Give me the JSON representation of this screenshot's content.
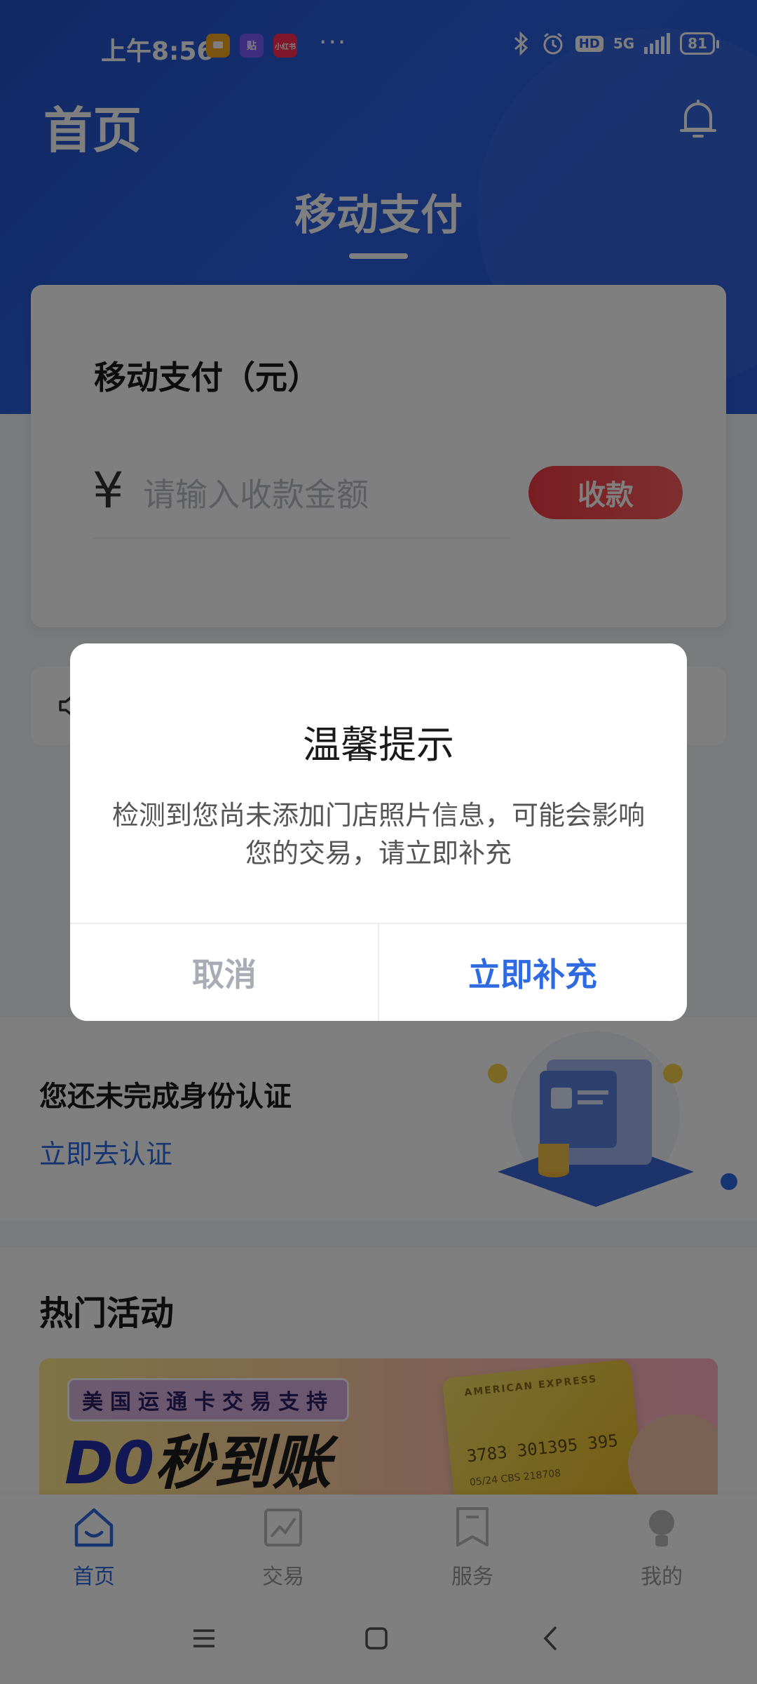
{
  "status_bar": {
    "time": "上午8:56",
    "notif_icons": [
      "chat-icon",
      "tieba-icon",
      "xiaohongshu-icon"
    ],
    "notif_labels": [
      "",
      "贴",
      "小红书"
    ],
    "more": "···",
    "network": "5G",
    "hd": "HD",
    "battery": "81"
  },
  "header": {
    "title": "首页"
  },
  "hero_tab": "移动支付",
  "pay_card": {
    "title": "移动支付（元）",
    "currency_symbol": "¥",
    "amount_placeholder": "请输入收款金额",
    "collect_button": "收款"
  },
  "verify": {
    "title": "您还未完成身份认证",
    "link": "立即去认证"
  },
  "activity": {
    "title": "热门活动",
    "banner_tag": "美国运通卡交易支持",
    "banner_do": "D0",
    "banner_headline": "秒到账",
    "card_brand": "AMERICAN EXPRESS",
    "card_number": "3783 301395 395",
    "card_sub": "05/24   CBS 218708"
  },
  "tabbar": [
    {
      "label": "首页",
      "icon": "home-icon",
      "active": true
    },
    {
      "label": "交易",
      "icon": "chart-icon",
      "active": false
    },
    {
      "label": "服务",
      "icon": "bookmark-icon",
      "active": false
    },
    {
      "label": "我的",
      "icon": "user-icon",
      "active": false
    }
  ],
  "dialog": {
    "title": "温馨提示",
    "message": "检测到您尚未添加门店照片信息，可能会影响您的交易，请立即补充",
    "cancel": "取消",
    "confirm": "立即补充"
  },
  "colors": {
    "primary_blue": "#2a5ad6",
    "link_blue": "#2f6ae0",
    "collect_red": "#f23a46",
    "overlay": "rgba(0,0,0,0.5)"
  }
}
